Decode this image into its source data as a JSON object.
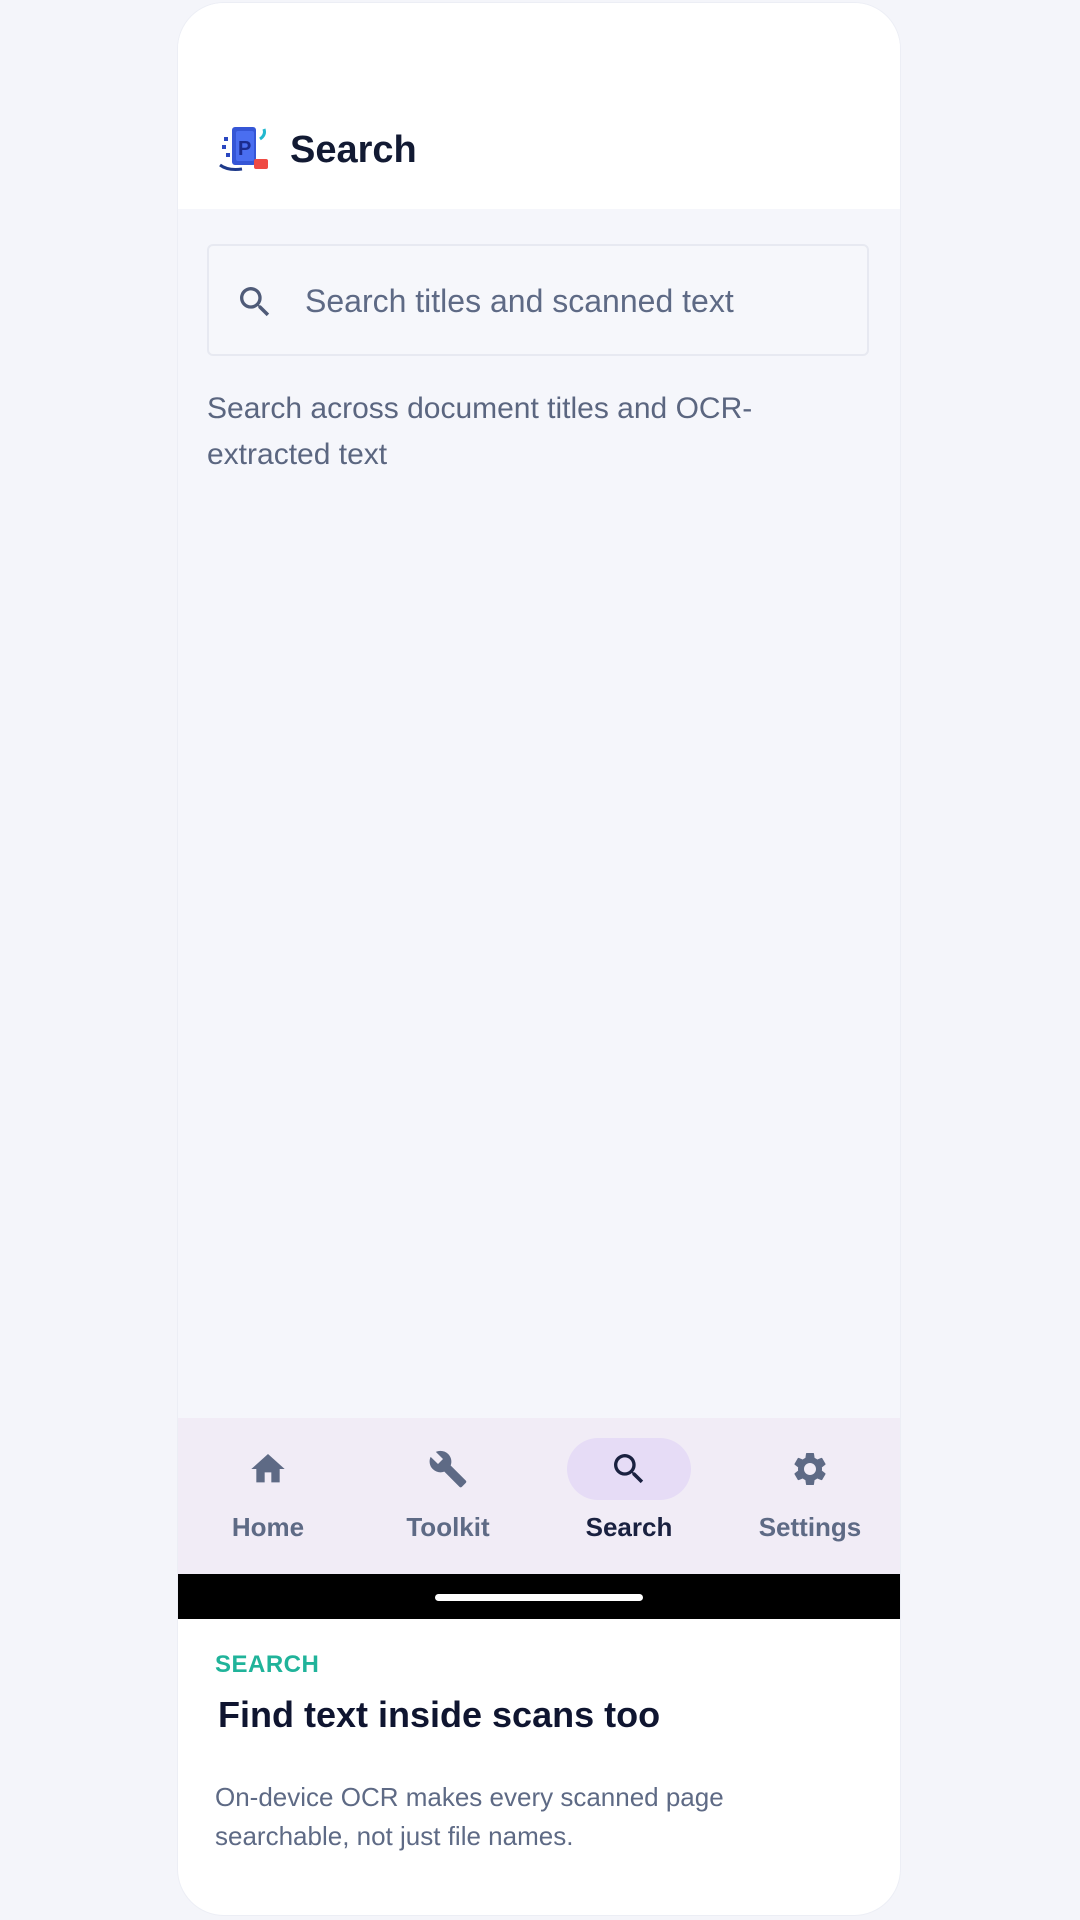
{
  "app_bar": {
    "title": "Search",
    "logo_icon": "pdf-scanner-logo-icon"
  },
  "search": {
    "placeholder": "Search titles and scanned text",
    "value": "",
    "icon": "search-icon",
    "helper_text": "Search across document titles and OCR-extracted text"
  },
  "nav": {
    "items": [
      {
        "label": "Home",
        "icon": "home-icon",
        "active": false
      },
      {
        "label": "Toolkit",
        "icon": "wrench-icon",
        "active": false
      },
      {
        "label": "Search",
        "icon": "search-icon",
        "active": true
      },
      {
        "label": "Settings",
        "icon": "gear-icon",
        "active": false
      }
    ]
  },
  "promo": {
    "eyebrow": "SEARCH",
    "title": "Find text inside scans too",
    "body": "On-device OCR makes every scanned page searchable, not just file names."
  },
  "colors": {
    "accent": "#20b39a",
    "nav_background": "#f1ecf6",
    "nav_active_pill": "#e6dcf6",
    "title_text": "#121a33",
    "muted_text": "#5e6a85"
  }
}
